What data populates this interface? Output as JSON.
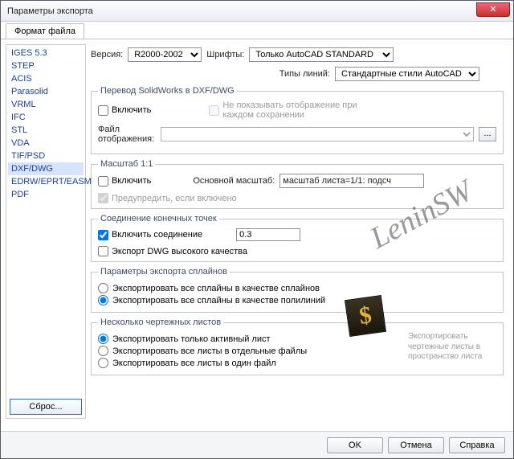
{
  "window": {
    "title": "Параметры экспорта",
    "close_glyph": "✕"
  },
  "tab": {
    "label": "Формат файла"
  },
  "sidebar": {
    "items": [
      {
        "label": "IGES 5.3"
      },
      {
        "label": "STEP"
      },
      {
        "label": "ACIS"
      },
      {
        "label": "Parasolid"
      },
      {
        "label": "VRML"
      },
      {
        "label": "IFC"
      },
      {
        "label": "STL"
      },
      {
        "label": "VDA"
      },
      {
        "label": "TIF/PSD"
      },
      {
        "label": "DXF/DWG",
        "selected": true
      },
      {
        "label": "EDRW/EPRT/EASM"
      },
      {
        "label": "PDF"
      }
    ],
    "reset": "Сброс..."
  },
  "toprow": {
    "version_label": "Версия:",
    "version_value": "R2000-2002",
    "fonts_label": "Шрифты:",
    "fonts_value": "Только AutoCAD STANDARD",
    "linetypes_label": "Типы линий:",
    "linetypes_value": "Стандартные стили AutoCAD"
  },
  "translate": {
    "legend": "Перевод SolidWorks в DXF/DWG",
    "enable": "Включить",
    "noshow": "Не показывать отображение при каждом сохранении",
    "map_label": "Файл отображения:",
    "map_value": "",
    "browse": "..."
  },
  "scale": {
    "legend": "Масштаб 1:1",
    "enable": "Включить",
    "base_label": "Основной масштаб:",
    "base_value": "масштаб листа=1/1: подсч",
    "warn": "Предупредить, если включено"
  },
  "endpoints": {
    "legend": "Соединение конечных точек",
    "enable": "Включить соединение",
    "tolerance": "0.3",
    "hq": "Экспорт DWG высокого качества"
  },
  "splines": {
    "legend": "Параметры экспорта сплайнов",
    "opt1": "Экспортировать все сплайны в качестве сплайнов",
    "opt2": "Экспортировать все сплайны в качестве полилиний"
  },
  "sheets": {
    "legend": "Несколько чертежных листов",
    "opt1": "Экспортировать только активный лист",
    "opt2": "Экспортировать все листы в отдельные файлы",
    "opt3": "Экспортировать все листы в один файл",
    "side": "Экспортировать чертежные листы в пространство листа"
  },
  "footer": {
    "ok": "OK",
    "cancel": "Отмена",
    "help": "Справка"
  },
  "watermark": {
    "text": "LeninSW",
    "glyph": "$"
  }
}
